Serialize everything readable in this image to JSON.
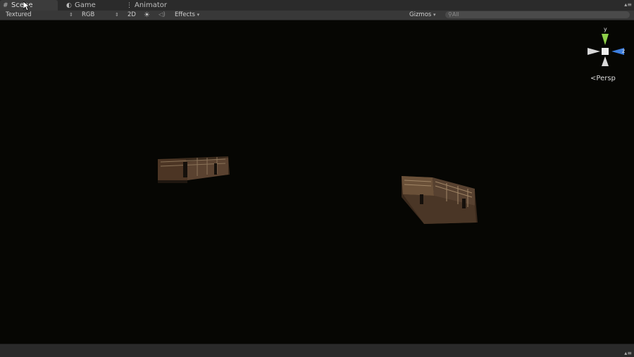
{
  "tabs": [
    {
      "label": "Scene",
      "icon": "grid-icon",
      "active": true
    },
    {
      "label": "Game",
      "icon": "pacman-icon",
      "active": false
    },
    {
      "label": "Animator",
      "icon": "animator-icon",
      "active": false
    }
  ],
  "toolbar": {
    "shading_mode": "Textured",
    "render_mode": "RGB",
    "mode_2d": "2D",
    "lighting_icon": "sun-icon",
    "audio_icon": "speaker-icon",
    "effects_label": "Effects",
    "gizmos_label": "Gizmos",
    "search_placeholder": "All"
  },
  "gizmo": {
    "y_label": "y",
    "z_label": "z",
    "projection_label": "Persp",
    "colors": {
      "y": "#8fd04a",
      "z": "#3d7fe0",
      "x_neutral": "#d8d8d8"
    }
  },
  "scene": {
    "objects": [
      "building-small",
      "building-large"
    ]
  }
}
